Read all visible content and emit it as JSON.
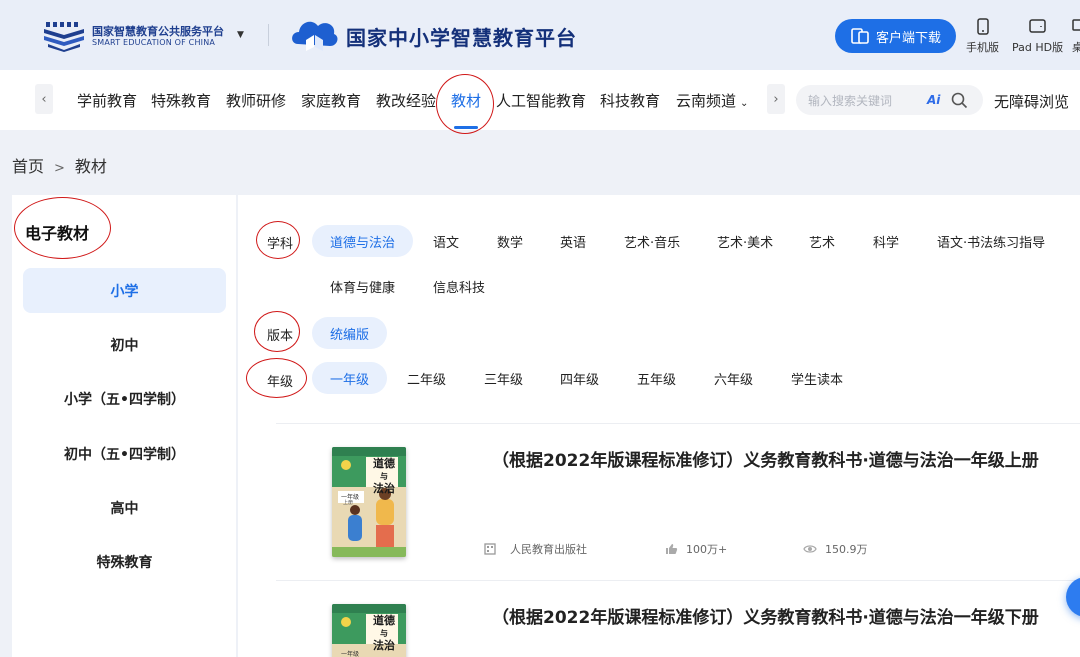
{
  "header": {
    "platform_name_cn": "国家智慧教育公共服务平台",
    "platform_name_en": "SMART EDUCATION OF CHINA",
    "site_title": "国家中小学智慧教育平台",
    "download_button": "客户端下载",
    "devices": [
      "手机版",
      "Pad HD版",
      "桌"
    ]
  },
  "nav": {
    "items": [
      "学前教育",
      "特殊教育",
      "教师研修",
      "家庭教育",
      "教改经验",
      "教材",
      "人工智能教育",
      "科技教育",
      "云南频道"
    ],
    "active": "教材",
    "search_placeholder": "输入搜索关键词",
    "search_ai": "Ai",
    "accessibility": "无障碍浏览"
  },
  "breadcrumb": {
    "home": "首页",
    "separator": ">",
    "current": "教材"
  },
  "sidebar": {
    "title": "电子教材",
    "items": [
      "小学",
      "初中",
      "小学（五•四学制）",
      "初中（五•四学制）",
      "高中",
      "特殊教育"
    ],
    "active": "小学"
  },
  "filters": {
    "subject": {
      "label": "学科",
      "options": [
        "道德与法治",
        "语文",
        "数学",
        "英语",
        "艺术·音乐",
        "艺术·美术",
        "艺术",
        "科学",
        "语文·书法练习指导",
        "体育与健康",
        "信息科技"
      ],
      "selected": "道德与法治"
    },
    "edition": {
      "label": "版本",
      "options": [
        "统编版"
      ],
      "selected": "统编版"
    },
    "grade": {
      "label": "年级",
      "options": [
        "一年级",
        "二年级",
        "三年级",
        "四年级",
        "五年级",
        "六年级",
        "学生读本"
      ],
      "selected": "一年级"
    }
  },
  "books": [
    {
      "title": "（根据2022年版课程标准修订）义务教育教科书·道德与法治一年级上册",
      "cover_title": [
        "道德",
        "与",
        "法治"
      ],
      "cover_grade": "一年级",
      "cover_term": "上册",
      "publisher": "人民教育出版社",
      "likes": "100万+",
      "views": "150.9万"
    },
    {
      "title": "（根据2022年版课程标准修订）义务教育教科书·道德与法治一年级下册",
      "cover_title": [
        "道德",
        "与",
        "法治"
      ],
      "cover_grade": "一年级"
    }
  ],
  "colors": {
    "accent": "#1e6fe6",
    "highlight_bg": "#e8f0fd",
    "annotation": "#d01818",
    "cover_green": "#3d9a5e"
  }
}
